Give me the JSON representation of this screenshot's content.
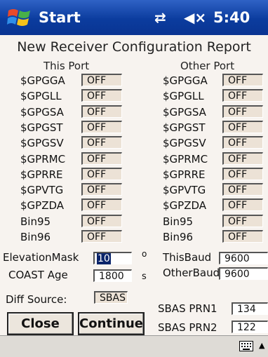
{
  "taskbar": {
    "title": "Start",
    "time": "5:40",
    "connectivity_icon": "network-sync-icon",
    "volume_icon": "speaker-muted-icon"
  },
  "report_title": "New Receiver  Configuration Report",
  "this_port": {
    "header": "This Port",
    "rows": [
      {
        "label": "$GPGGA",
        "value": "OFF"
      },
      {
        "label": "$GPGLL",
        "value": "OFF"
      },
      {
        "label": "$GPGSA",
        "value": "OFF"
      },
      {
        "label": "$GPGST",
        "value": "OFF"
      },
      {
        "label": "$GPGSV",
        "value": "OFF"
      },
      {
        "label": "$GPRMC",
        "value": "OFF"
      },
      {
        "label": "$GPRRE",
        "value": "OFF"
      },
      {
        "label": "$GPVTG",
        "value": "OFF"
      },
      {
        "label": "$GPZDA",
        "value": "OFF"
      },
      {
        "label": "Bin95",
        "value": "OFF"
      },
      {
        "label": "Bin96",
        "value": "OFF"
      }
    ]
  },
  "other_port": {
    "header": "Other Port",
    "rows": [
      {
        "label": "$GPGGA",
        "value": "OFF"
      },
      {
        "label": "$GPGLL",
        "value": "OFF"
      },
      {
        "label": "$GPGSA",
        "value": "OFF"
      },
      {
        "label": "$GPGST",
        "value": "OFF"
      },
      {
        "label": "$GPGSV",
        "value": "OFF"
      },
      {
        "label": "$GPRMC",
        "value": "OFF"
      },
      {
        "label": "$GPRRE",
        "value": "OFF"
      },
      {
        "label": "$GPVTG",
        "value": "OFF"
      },
      {
        "label": "$GPZDA",
        "value": "OFF"
      },
      {
        "label": "Bin95",
        "value": "OFF"
      },
      {
        "label": "Bin96",
        "value": "OFF"
      }
    ]
  },
  "settings": {
    "elevation_mask": {
      "label": "ElevationMask",
      "value": "10",
      "unit": "o"
    },
    "coast_age": {
      "label": "COAST Age",
      "value": "1800",
      "unit": "s"
    },
    "this_baud": {
      "label": "ThisBaud",
      "value": "9600"
    },
    "other_baud": {
      "label": "OtherBaud",
      "value": "9600"
    },
    "diff_source": {
      "label": "Diff Source:",
      "value": "SBAS"
    },
    "sbas_prn1": {
      "label": "SBAS PRN1",
      "value": "134"
    },
    "sbas_prn2": {
      "label": "SBAS PRN2",
      "value": "122"
    }
  },
  "buttons": {
    "close": "Close",
    "continue": "Continue"
  },
  "menubar": {
    "keyboard_icon": "keyboard-icon",
    "caret_icon": "up-caret-icon"
  }
}
